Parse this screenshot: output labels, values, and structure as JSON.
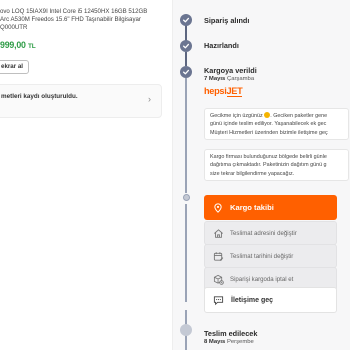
{
  "product": {
    "title_lines": [
      "ovo LOQ 15IAX9I Intel Core i5 12450HX 16GB 512GB",
      "Arc A530M Freedos 15.6\" FHD Taşınabilir Bilgisayar",
      "Q000UTR"
    ],
    "price": "999,00",
    "currency": "TL",
    "ask_button": "ekrar al"
  },
  "request": {
    "text": "metleri kaydı oluşturuldu."
  },
  "timeline": {
    "steps": [
      {
        "label": "Sipariş alındı"
      },
      {
        "label": "Hazırlandı"
      },
      {
        "label": "Kargoya verildi",
        "date_day": "7 Mayıs",
        "date_weekday": "Çarşamba"
      }
    ],
    "carrier_brand": {
      "main": "hepsi",
      "accent": "JET"
    },
    "delay_message": [
      "Gecikme için üzgünüz",
      "günü içinde teslim ediliyor. Yaşanabilecek ek gec",
      "Müşteri Hizmetleri üzerinden bizimle iletişime geç"
    ],
    "delay_message_tail": ". Geciken paketler gene",
    "failure_message": [
      "Kargo firması bulunduğunuz bölgede belirli günle",
      "dağıtıma çıkmaktadır. Paketinizin dağıtım günü g",
      "size tekrar bilgilendirme yapacağız."
    ],
    "track_button": "Kargo takibi",
    "actions": [
      {
        "label": "Teslimat adresini değiştir",
        "icon": "home-edit-icon"
      },
      {
        "label": "Teslimat tarihini değiştir",
        "icon": "calendar-edit-icon"
      },
      {
        "label": "Siparişi kargoda iptal et",
        "icon": "package-cancel-icon"
      }
    ],
    "contact_button": "İletişime geç",
    "final_step": {
      "label": "Teslim edilecek",
      "date_day": "8 Mayıs",
      "date_weekday": "Perşembe"
    }
  },
  "colors": {
    "accent": "#ff6000",
    "price": "#2e9c46",
    "timeline": "#6b7591"
  }
}
